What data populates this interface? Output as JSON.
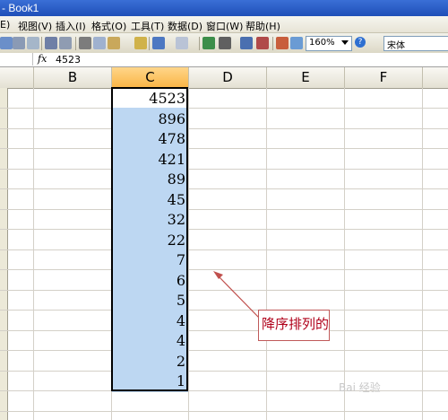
{
  "window": {
    "title": "- Book1"
  },
  "menu": [
    "E)",
    "视图(V)",
    "插入(I)",
    "格式(O)",
    "工具(T)",
    "数据(D)",
    "窗口(W)",
    "帮助(H)"
  ],
  "toolbar": {
    "zoom": "160%",
    "font": "宋体",
    "help": "?"
  },
  "formula_bar": {
    "fx": "fx",
    "value": "4523"
  },
  "columns": [
    "B",
    "C",
    "D",
    "E",
    "F"
  ],
  "active_column": "C",
  "cells_C": [
    "4523",
    "896",
    "478",
    "421",
    "89",
    "45",
    "32",
    "22",
    "7",
    "6",
    "5",
    "4",
    "4",
    "2",
    "1"
  ],
  "annotation": {
    "text": "降序排列的"
  },
  "watermark": "Bai 经验"
}
